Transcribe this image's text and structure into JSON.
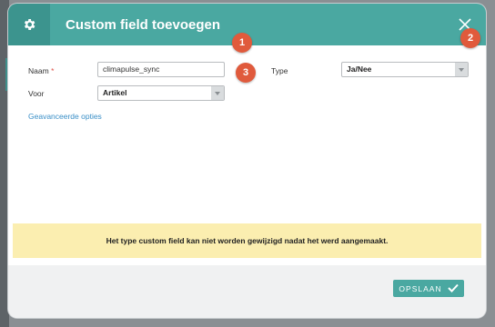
{
  "dialog": {
    "title": "Custom field toevoegen",
    "close_icon": "close-icon",
    "settings_icon": "gear-icon"
  },
  "form": {
    "name_label": "Naam",
    "required_mark": "*",
    "name_value": "climapulse_sync",
    "voor_label": "Voor",
    "voor_value": "Artikel",
    "type_label": "Type",
    "type_value": "Ja/Nee",
    "advanced_link": "Geavanceerde opties"
  },
  "notice": {
    "text": "Het type custom field kan niet worden gewijzigd nadat het werd aangemaakt."
  },
  "footer": {
    "save_label": "OPSLAAN",
    "save_icon": "checkmark-icon"
  },
  "annotations": [
    "1",
    "2",
    "3"
  ],
  "colors": {
    "header": "#4aa8a1",
    "header_dark": "#3c948e",
    "badge": "#e05a3c",
    "notice_bg": "#fbeeb0",
    "link": "#3a8fc7"
  }
}
